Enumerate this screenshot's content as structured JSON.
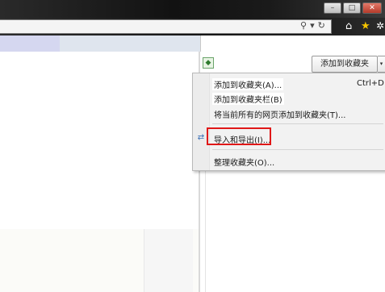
{
  "address_bar": {
    "search_icon": "search-icon",
    "separator": "▾",
    "refresh_icon": "refresh-icon"
  },
  "toolbar": {
    "home_icon": "home-icon",
    "favorites_icon": "star-icon",
    "tools_icon": "gear-icon"
  },
  "favorites_bar": {
    "add_button_label": "添加到收藏夹",
    "dropdown_arrow": "▾"
  },
  "menu": {
    "items": [
      {
        "label": "添加到收藏夹(A)...",
        "shortcut": "Ctrl+D"
      },
      {
        "label": "添加到收藏夹栏(B)"
      },
      {
        "label": "将当前所有的网页添加到收藏夹(T)..."
      },
      {
        "label": "导入和导出(I)..."
      },
      {
        "label": "整理收藏夹(O)..."
      }
    ]
  },
  "colors": {
    "highlight_box": "#e01818",
    "star": "#f5c400"
  }
}
